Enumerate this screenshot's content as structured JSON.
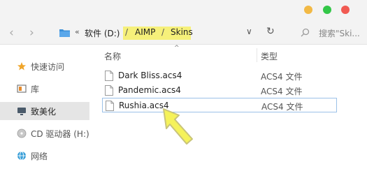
{
  "window": {
    "controls": [
      "minimize-button",
      "maximize-button",
      "close-button"
    ]
  },
  "toolbar": {
    "back_icon": "‹",
    "forward_icon": "›",
    "overflow_chevron": "«",
    "breadcrumb": {
      "drive": "软件 (D:)",
      "separator": "/",
      "folder1": "AIMP",
      "folder2": "Skins"
    },
    "dropdown_icon": "∨",
    "refresh_icon": "↻",
    "search_placeholder": "搜索\"Ski..."
  },
  "sidebar": {
    "items": [
      {
        "label": "快速访问",
        "icon": "star-icon"
      },
      {
        "label": "库",
        "icon": "library-icon"
      },
      {
        "label": "致美化",
        "icon": "monitor-icon",
        "selected": true
      },
      {
        "label": "CD 驱动器 (H:)",
        "icon": "cd-drive-icon"
      },
      {
        "label": "网络",
        "icon": "network-icon"
      }
    ]
  },
  "columns": {
    "name": "名称",
    "sort_indicator": "^",
    "type": "类型"
  },
  "files": [
    {
      "name": "Dark Bliss.acs4",
      "type": "ACS4 文件"
    },
    {
      "name": "Pandemic.acs4",
      "type": "ACS4 文件"
    },
    {
      "name": "Rushia.acs4",
      "type": "ACS4 文件",
      "focused": true
    }
  ],
  "colors": {
    "highlight": "#f6f07a",
    "pointer": "#f5f25a",
    "focus_border": "#9bc1e8",
    "selected_bg": "#e5e5e5"
  }
}
